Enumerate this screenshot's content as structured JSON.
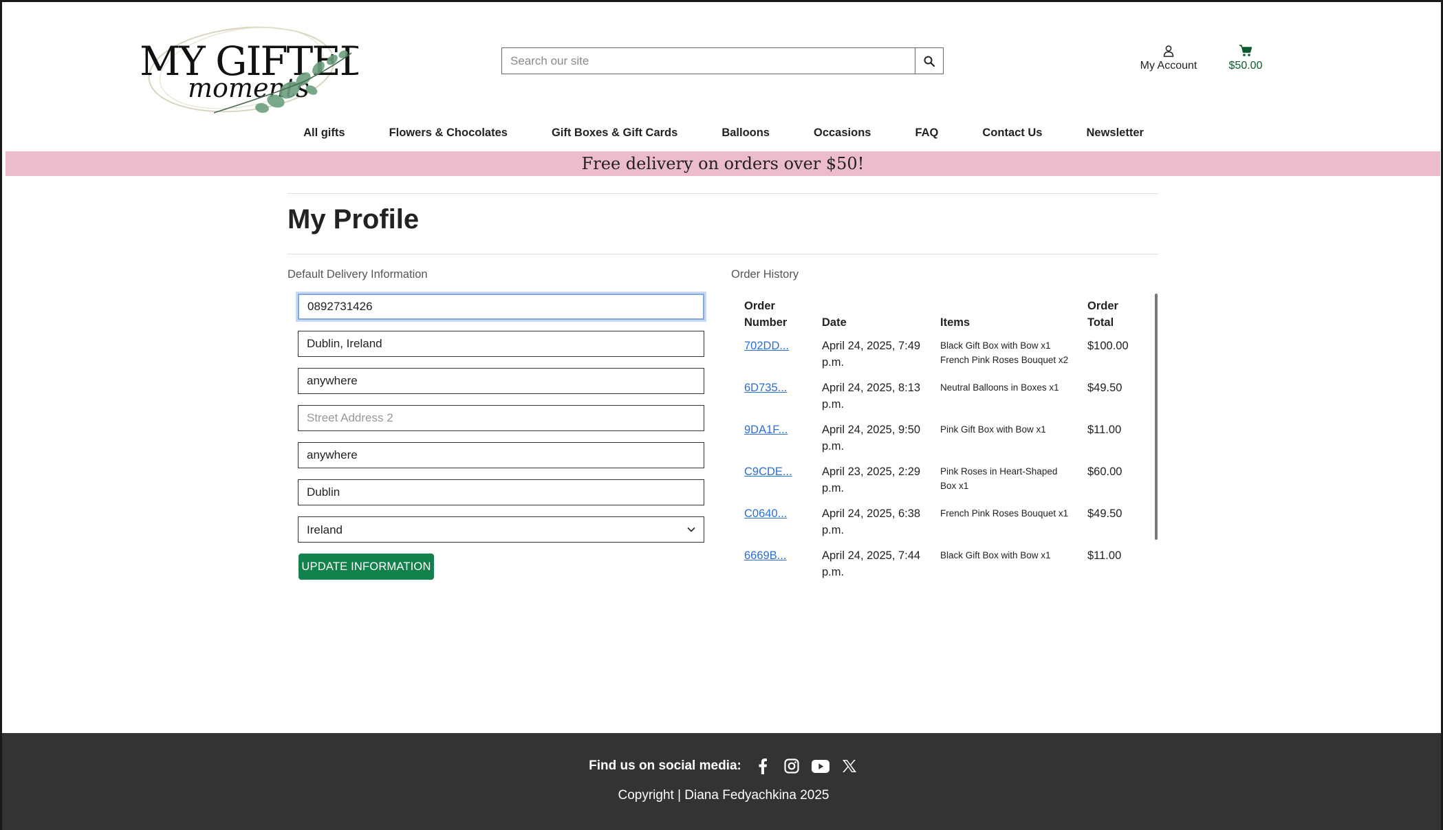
{
  "header": {
    "logo_text_top": "MY GIFTED",
    "logo_text_bottom": "moments",
    "search_placeholder": "Search our site",
    "account_label": "My Account",
    "cart_total": "$50.00",
    "brand_green": "#0d5a2c"
  },
  "nav": {
    "items": [
      {
        "label": "All gifts"
      },
      {
        "label": "Flowers & Chocolates"
      },
      {
        "label": "Gift Boxes & Gift Cards"
      },
      {
        "label": "Balloons"
      },
      {
        "label": "Occasions"
      },
      {
        "label": "FAQ"
      },
      {
        "label": "Contact Us"
      },
      {
        "label": "Newsletter"
      }
    ]
  },
  "banner": {
    "text": "Free delivery on orders over $50!",
    "color": "#ecbccb"
  },
  "profile": {
    "title": "My Profile",
    "delivery_label": "Default Delivery Information",
    "fields": {
      "phone": "0892731426",
      "town": "Dublin, Ireland",
      "street1": "anywhere",
      "street2_placeholder": "Street Address 2",
      "county": "anywhere",
      "postcode": "Dublin",
      "country": "Ireland"
    },
    "update_button": "UPDATE INFORMATION",
    "button_color": "#12814b"
  },
  "orders": {
    "label": "Order History",
    "headers": {
      "number_line1": "Order",
      "number_line2": "Number",
      "date": "Date",
      "items": "Items",
      "total_line1": "Order",
      "total_line2": "Total"
    },
    "rows": [
      {
        "number": "702DD...",
        "date_line1": "April 24, 2025, 7:49",
        "date_line2": "p.m.",
        "item1": "Black Gift Box with Bow x1",
        "item2": "French Pink Roses Bouquet x2",
        "total": "$100.00"
      },
      {
        "number": "6D735...",
        "date_line1": "April 24, 2025, 8:13",
        "date_line2": "p.m.",
        "item1": "Neutral Balloons in Boxes x1",
        "item2": "",
        "total": "$49.50"
      },
      {
        "number": "9DA1F...",
        "date_line1": "April 24, 2025, 9:50",
        "date_line2": "p.m.",
        "item1": "Pink Gift Box with Bow x1",
        "item2": "",
        "total": "$11.00"
      },
      {
        "number": "C9CDE...",
        "date_line1": "April 23, 2025, 2:29",
        "date_line2": "p.m.",
        "item1": "Pink Roses in Heart-Shaped",
        "item2": "Box x1",
        "total": "$60.00"
      },
      {
        "number": "C0640...",
        "date_line1": "April 24, 2025, 6:38",
        "date_line2": "p.m.",
        "item1": "French Pink Roses Bouquet x1",
        "item2": "",
        "total": "$49.50"
      },
      {
        "number": "6669B...",
        "date_line1": "April 24, 2025, 7:44",
        "date_line2": "p.m.",
        "item1": "Black Gift Box with Bow x1",
        "item2": "",
        "total": "$11.00"
      }
    ]
  },
  "footer": {
    "social_label": "Find us on social media:",
    "social_icons": [
      "facebook-icon",
      "instagram-icon",
      "youtube-icon",
      "x-icon"
    ],
    "copyright": "Copyright | Diana Fedyachkina 2025",
    "background": "#333333"
  }
}
